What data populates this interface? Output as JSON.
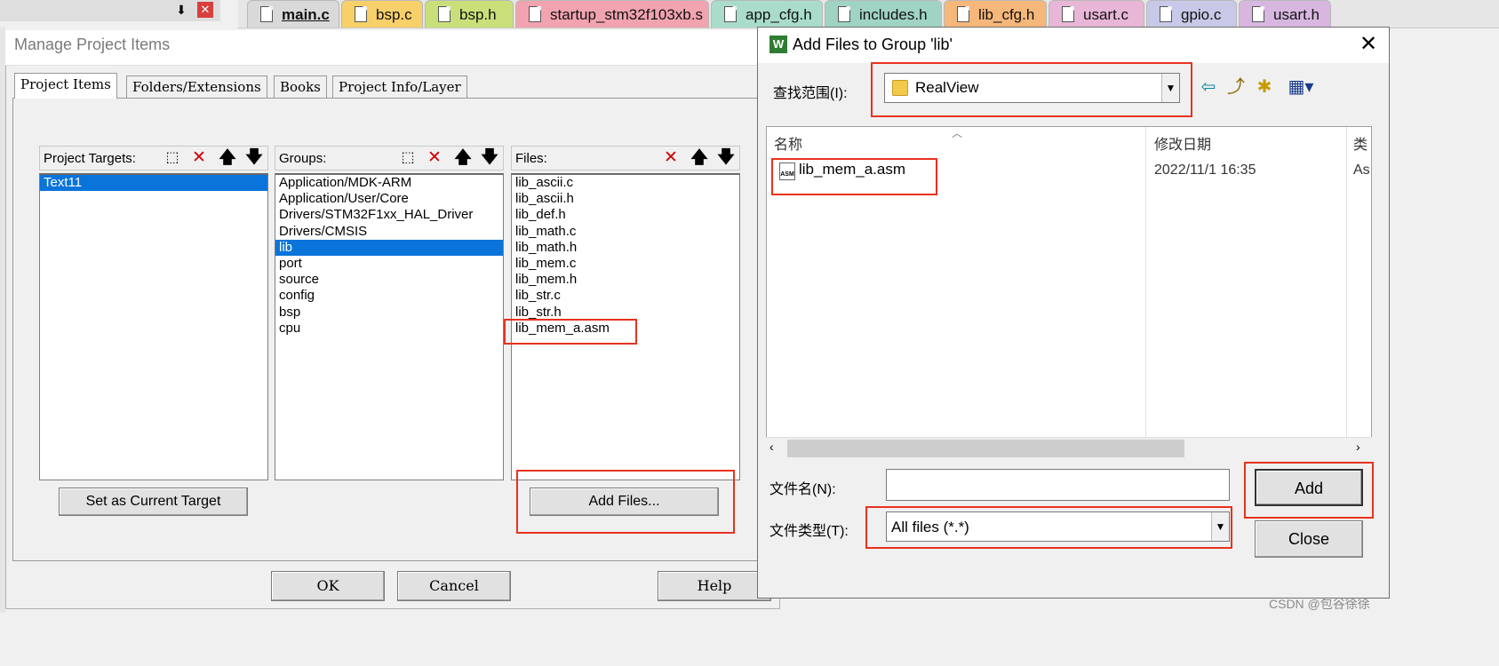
{
  "editor": {
    "pin_glyph": "⬇",
    "close_glyph": "✕",
    "tabs": [
      {
        "label": "main.c",
        "color": "#d9d9d9"
      },
      {
        "label": "bsp.c",
        "color": "#f7d06a"
      },
      {
        "label": "bsp.h",
        "color": "#c9e07a"
      },
      {
        "label": "startup_stm32f103xb.s",
        "color": "#f2a3b0"
      },
      {
        "label": "app_cfg.h",
        "color": "#a9dccb"
      },
      {
        "label": "includes.h",
        "color": "#9fd3c4"
      },
      {
        "label": "lib_cfg.h",
        "color": "#f6b77a"
      },
      {
        "label": "usart.c",
        "color": "#e8b6d6"
      },
      {
        "label": "gpio.c",
        "color": "#c8c9e8"
      },
      {
        "label": "usart.h",
        "color": "#d7b7e0"
      }
    ]
  },
  "manage_dialog": {
    "title": "Manage Project Items",
    "tabs": [
      "Project Items",
      "Folders/Extensions",
      "Books",
      "Project Info/Layer"
    ],
    "targets": {
      "label": "Project Targets:",
      "items": [
        "Text11"
      ],
      "selected": 0
    },
    "groups": {
      "label": "Groups:",
      "items": [
        "Application/MDK-ARM",
        "Application/User/Core",
        "Drivers/STM32F1xx_HAL_Driver",
        "Drivers/CMSIS",
        "lib",
        "port",
        "source",
        "config",
        "bsp",
        "cpu"
      ],
      "selected": 4
    },
    "files": {
      "label": "Files:",
      "items": [
        "lib_ascii.c",
        "lib_ascii.h",
        "lib_def.h",
        "lib_math.c",
        "lib_math.h",
        "lib_mem.c",
        "lib_mem.h",
        "lib_str.c",
        "lib_str.h",
        "lib_mem_a.asm"
      ]
    },
    "set_current_target_label": "Set as Current Target",
    "add_files_label": "Add Files...",
    "ok_label": "OK",
    "cancel_label": "Cancel",
    "help_label": "Help",
    "icons": {
      "new": "⬚",
      "delete": "✕",
      "up": "🡅",
      "down": "🡇"
    }
  },
  "add_dialog": {
    "title": "Add Files to Group 'lib'",
    "icon_letter": "W",
    "close_glyph": "✕",
    "lookin_label": "查找范围(I):",
    "lookin_value": "RealView",
    "col_name": "名称",
    "col_date": "修改日期",
    "col_type": "类",
    "file": {
      "name": "lib_mem_a.asm",
      "date": "2022/11/1 16:35",
      "type": "As"
    },
    "filename_label": "文件名(N):",
    "filename_value": "",
    "filetype_label": "文件类型(T):",
    "filetype_value": "All files (*.*)",
    "add_label": "Add",
    "close_label": "Close",
    "toolbar_glyphs": {
      "back": "⇦",
      "up_folder": "⤴",
      "new_folder": "✱",
      "view_menu": "▦▾"
    }
  },
  "watermark": "CSDN @包谷徐徐"
}
